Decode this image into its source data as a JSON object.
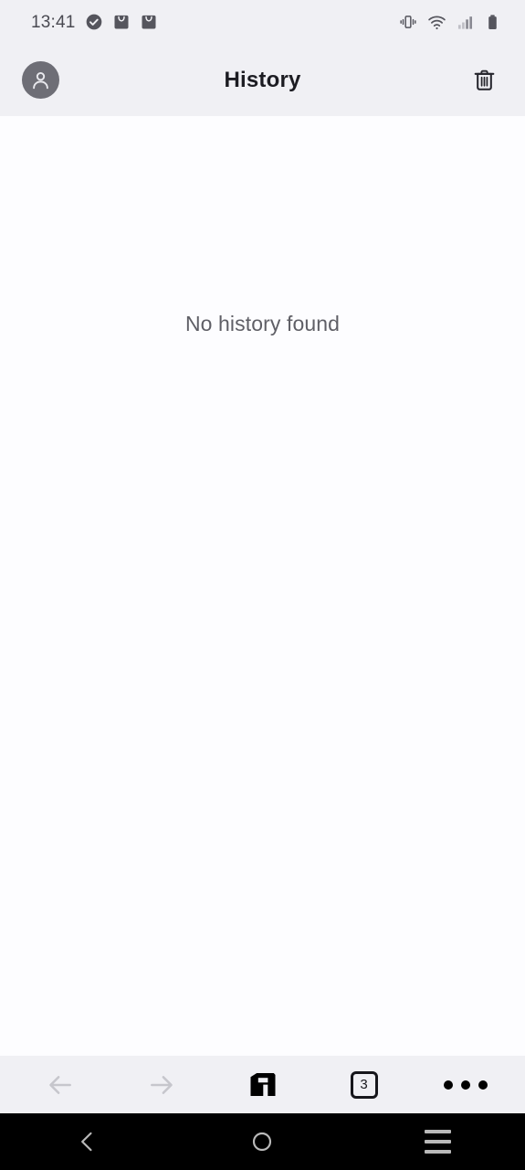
{
  "status_bar": {
    "time": "13:41",
    "left_icons": [
      {
        "name": "check-circle-icon",
        "label": "Completed"
      },
      {
        "name": "shopping-bag-icon",
        "label": "Store download"
      },
      {
        "name": "shopping-bag-icon-2",
        "label": "Store download"
      }
    ],
    "right_icons": [
      {
        "name": "vibrate-icon",
        "label": "Vibrate mode"
      },
      {
        "name": "wifi-icon",
        "label": "Wi-Fi"
      },
      {
        "name": "signal-icon",
        "label": "Cellular signal"
      },
      {
        "name": "battery-icon",
        "label": "Battery"
      }
    ]
  },
  "header": {
    "title": "History",
    "avatar_label": "Account",
    "delete_label": "Clear history"
  },
  "main": {
    "empty_message": "No history found"
  },
  "toolbar": {
    "back_label": "Back",
    "forward_label": "Forward",
    "home_label": "Maxthon home",
    "tabs_count": "3",
    "menu_label": "More options"
  },
  "android_nav": {
    "back_label": "Back",
    "home_label": "Home",
    "recents_label": "Recent apps"
  },
  "colors": {
    "chrome_bg": "#f0f0f4",
    "content_bg": "#fdfdff",
    "title_text": "#1c1c22",
    "muted_text": "#5f5f66",
    "disabled_icon": "#c6c6cc",
    "nav_bg": "#000000",
    "nav_icon": "#b9b9b9"
  }
}
